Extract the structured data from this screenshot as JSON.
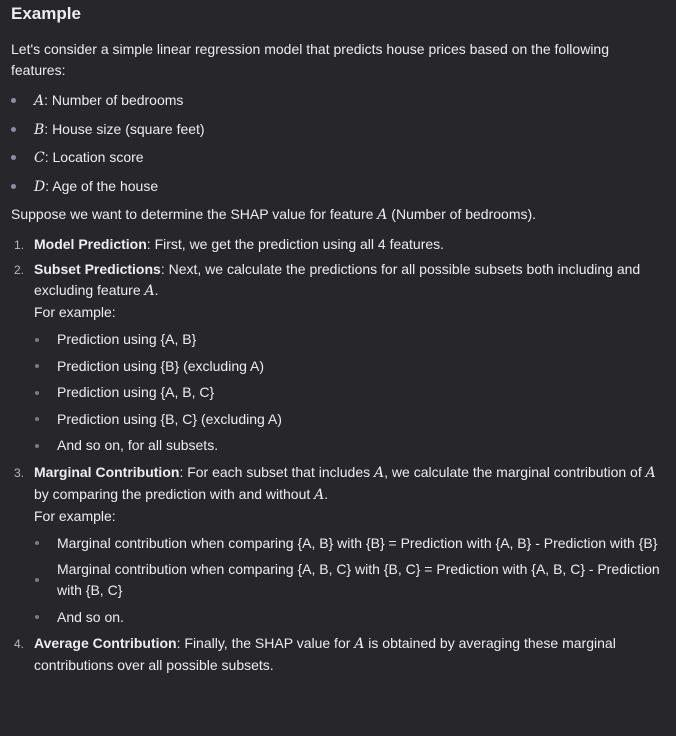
{
  "heading": "Example",
  "intro": "Let's consider a simple linear regression model that predicts house prices based on the following features:",
  "features": [
    {
      "var": "A",
      "text": ": Number of bedrooms"
    },
    {
      "var": "B",
      "text": ": House size (square feet)"
    },
    {
      "var": "C",
      "text": ": Location score"
    },
    {
      "var": "D",
      "text": ": Age of the house"
    }
  ],
  "suppose": {
    "before": "Suppose we want to determine the SHAP value for feature ",
    "var": "A",
    "after": " (Number of bedrooms)."
  },
  "steps": [
    {
      "num": "1.",
      "title": "Model Prediction",
      "text": ": First, we get the prediction using all 4 features."
    },
    {
      "num": "2.",
      "title": "Subset Predictions",
      "text": ": Next, we calculate the predictions for all possible subsets both including and excluding feature ",
      "var": "A",
      "after": ".",
      "example_label": "For example:",
      "items": [
        "Prediction using {A, B}",
        "Prediction using {B} (excluding A)",
        "Prediction using {A, B, C}",
        "Prediction using {B, C} (excluding A)",
        "And so on, for all subsets."
      ]
    },
    {
      "num": "3.",
      "title": "Marginal Contribution",
      "text1": ": For each subset that includes ",
      "var1": "A",
      "text2": ", we calculate the marginal contribution of ",
      "var2": "A",
      "text3": " by comparing the prediction with and without ",
      "var3": "A",
      "text4": ".",
      "example_label": "For example:",
      "items": [
        "Marginal contribution when comparing {A, B} with {B} = Prediction with {A, B} - Prediction with {B}",
        "Marginal contribution when comparing {A, B, C} with {B, C} = Prediction with {A, B, C} - Prediction with {B, C}",
        "And so on."
      ]
    },
    {
      "num": "4.",
      "title": "Average Contribution",
      "text1": ": Finally, the SHAP value for ",
      "var1": "A",
      "text2": " is obtained by averaging these marginal contributions over all possible subsets."
    }
  ]
}
